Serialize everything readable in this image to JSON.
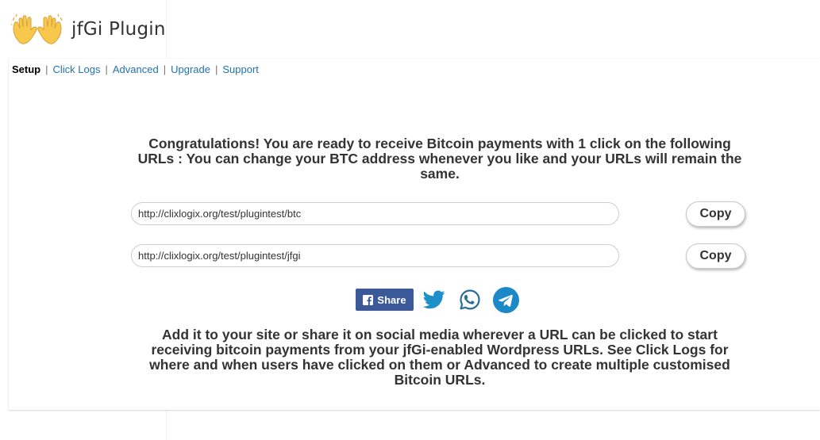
{
  "header": {
    "logo_icon": "waving-hands-icon",
    "title": "jfGi Plugin"
  },
  "nav": {
    "items": [
      {
        "label": "Setup",
        "active": true
      },
      {
        "label": "Click Logs",
        "active": false
      },
      {
        "label": "Advanced",
        "active": false
      },
      {
        "label": "Upgrade",
        "active": false
      },
      {
        "label": "Support",
        "active": false
      }
    ],
    "separator": "|"
  },
  "main": {
    "congrats_text": "Congratulations! You are ready to receive Bitcoin payments with 1 click on the following URLs : You can change your BTC address whenever you like and your URLs will remain the same.",
    "urls": [
      {
        "value": "http://clixlogix.org/test/plugintest/btc",
        "copy_label": "Copy"
      },
      {
        "value": "http://clixlogix.org/test/plugintest/jfgi",
        "copy_label": "Copy"
      }
    ],
    "share": {
      "facebook_label": "Share",
      "icons": [
        "facebook-icon",
        "twitter-icon",
        "whatsapp-icon",
        "telegram-icon"
      ]
    },
    "footer_text": "Add it to your site or share it on social media wherever a URL can be clicked to start receiving bitcoin payments from your jfGi-enabled Wordpress URLs. See Click Logs for where and when users have clicked on them or Advanced to create multiple customised Bitcoin URLs."
  },
  "colors": {
    "link": "#2271b1",
    "text": "#333333",
    "facebook": "#3b5998",
    "twitter": "#1d8fc9",
    "telegram": "#1b88c8",
    "whatsapp": "#2a6f96"
  }
}
